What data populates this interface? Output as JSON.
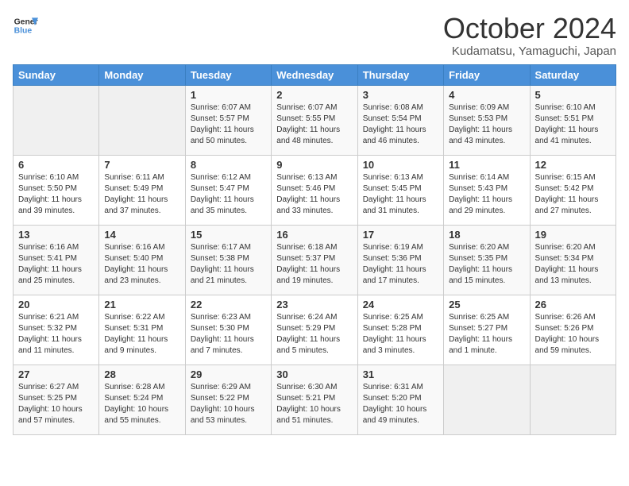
{
  "logo": {
    "line1": "General",
    "line2": "Blue"
  },
  "title": "October 2024",
  "location": "Kudamatsu, Yamaguchi, Japan",
  "weekdays": [
    "Sunday",
    "Monday",
    "Tuesday",
    "Wednesday",
    "Thursday",
    "Friday",
    "Saturday"
  ],
  "weeks": [
    [
      {
        "day": "",
        "detail": ""
      },
      {
        "day": "",
        "detail": ""
      },
      {
        "day": "1",
        "detail": "Sunrise: 6:07 AM\nSunset: 5:57 PM\nDaylight: 11 hours\nand 50 minutes."
      },
      {
        "day": "2",
        "detail": "Sunrise: 6:07 AM\nSunset: 5:55 PM\nDaylight: 11 hours\nand 48 minutes."
      },
      {
        "day": "3",
        "detail": "Sunrise: 6:08 AM\nSunset: 5:54 PM\nDaylight: 11 hours\nand 46 minutes."
      },
      {
        "day": "4",
        "detail": "Sunrise: 6:09 AM\nSunset: 5:53 PM\nDaylight: 11 hours\nand 43 minutes."
      },
      {
        "day": "5",
        "detail": "Sunrise: 6:10 AM\nSunset: 5:51 PM\nDaylight: 11 hours\nand 41 minutes."
      }
    ],
    [
      {
        "day": "6",
        "detail": "Sunrise: 6:10 AM\nSunset: 5:50 PM\nDaylight: 11 hours\nand 39 minutes."
      },
      {
        "day": "7",
        "detail": "Sunrise: 6:11 AM\nSunset: 5:49 PM\nDaylight: 11 hours\nand 37 minutes."
      },
      {
        "day": "8",
        "detail": "Sunrise: 6:12 AM\nSunset: 5:47 PM\nDaylight: 11 hours\nand 35 minutes."
      },
      {
        "day": "9",
        "detail": "Sunrise: 6:13 AM\nSunset: 5:46 PM\nDaylight: 11 hours\nand 33 minutes."
      },
      {
        "day": "10",
        "detail": "Sunrise: 6:13 AM\nSunset: 5:45 PM\nDaylight: 11 hours\nand 31 minutes."
      },
      {
        "day": "11",
        "detail": "Sunrise: 6:14 AM\nSunset: 5:43 PM\nDaylight: 11 hours\nand 29 minutes."
      },
      {
        "day": "12",
        "detail": "Sunrise: 6:15 AM\nSunset: 5:42 PM\nDaylight: 11 hours\nand 27 minutes."
      }
    ],
    [
      {
        "day": "13",
        "detail": "Sunrise: 6:16 AM\nSunset: 5:41 PM\nDaylight: 11 hours\nand 25 minutes."
      },
      {
        "day": "14",
        "detail": "Sunrise: 6:16 AM\nSunset: 5:40 PM\nDaylight: 11 hours\nand 23 minutes."
      },
      {
        "day": "15",
        "detail": "Sunrise: 6:17 AM\nSunset: 5:38 PM\nDaylight: 11 hours\nand 21 minutes."
      },
      {
        "day": "16",
        "detail": "Sunrise: 6:18 AM\nSunset: 5:37 PM\nDaylight: 11 hours\nand 19 minutes."
      },
      {
        "day": "17",
        "detail": "Sunrise: 6:19 AM\nSunset: 5:36 PM\nDaylight: 11 hours\nand 17 minutes."
      },
      {
        "day": "18",
        "detail": "Sunrise: 6:20 AM\nSunset: 5:35 PM\nDaylight: 11 hours\nand 15 minutes."
      },
      {
        "day": "19",
        "detail": "Sunrise: 6:20 AM\nSunset: 5:34 PM\nDaylight: 11 hours\nand 13 minutes."
      }
    ],
    [
      {
        "day": "20",
        "detail": "Sunrise: 6:21 AM\nSunset: 5:32 PM\nDaylight: 11 hours\nand 11 minutes."
      },
      {
        "day": "21",
        "detail": "Sunrise: 6:22 AM\nSunset: 5:31 PM\nDaylight: 11 hours\nand 9 minutes."
      },
      {
        "day": "22",
        "detail": "Sunrise: 6:23 AM\nSunset: 5:30 PM\nDaylight: 11 hours\nand 7 minutes."
      },
      {
        "day": "23",
        "detail": "Sunrise: 6:24 AM\nSunset: 5:29 PM\nDaylight: 11 hours\nand 5 minutes."
      },
      {
        "day": "24",
        "detail": "Sunrise: 6:25 AM\nSunset: 5:28 PM\nDaylight: 11 hours\nand 3 minutes."
      },
      {
        "day": "25",
        "detail": "Sunrise: 6:25 AM\nSunset: 5:27 PM\nDaylight: 11 hours\nand 1 minute."
      },
      {
        "day": "26",
        "detail": "Sunrise: 6:26 AM\nSunset: 5:26 PM\nDaylight: 10 hours\nand 59 minutes."
      }
    ],
    [
      {
        "day": "27",
        "detail": "Sunrise: 6:27 AM\nSunset: 5:25 PM\nDaylight: 10 hours\nand 57 minutes."
      },
      {
        "day": "28",
        "detail": "Sunrise: 6:28 AM\nSunset: 5:24 PM\nDaylight: 10 hours\nand 55 minutes."
      },
      {
        "day": "29",
        "detail": "Sunrise: 6:29 AM\nSunset: 5:22 PM\nDaylight: 10 hours\nand 53 minutes."
      },
      {
        "day": "30",
        "detail": "Sunrise: 6:30 AM\nSunset: 5:21 PM\nDaylight: 10 hours\nand 51 minutes."
      },
      {
        "day": "31",
        "detail": "Sunrise: 6:31 AM\nSunset: 5:20 PM\nDaylight: 10 hours\nand 49 minutes."
      },
      {
        "day": "",
        "detail": ""
      },
      {
        "day": "",
        "detail": ""
      }
    ]
  ]
}
